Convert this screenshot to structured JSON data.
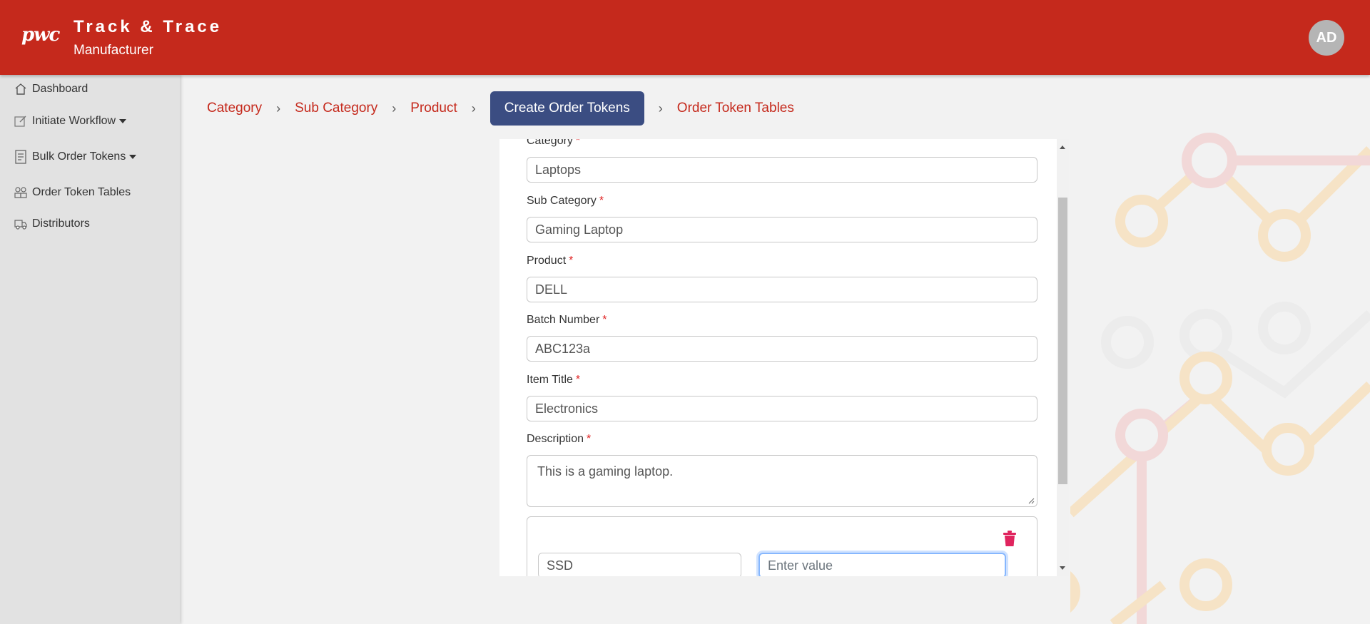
{
  "header": {
    "logo": "pwc",
    "title": "Track & Trace",
    "subtitle": "Manufacturer",
    "avatar_initials": "AD",
    "brand_color": "#c5291c"
  },
  "sidebar": {
    "items": [
      {
        "label": "Dashboard",
        "icon": "home-icon"
      },
      {
        "label": "Initiate Workflow",
        "icon": "edit-icon",
        "dropdown": true
      },
      {
        "label": "Bulk Order Tokens",
        "icon": "document-icon",
        "dropdown": true
      },
      {
        "label": "Order Token Tables",
        "icon": "users-icon"
      },
      {
        "label": "Distributors",
        "icon": "truck-icon"
      }
    ]
  },
  "breadcrumb": {
    "items": [
      "Category",
      "Sub Category",
      "Product",
      "Create Order Tokens",
      "Order Token Tables"
    ],
    "active": "Create Order Tokens",
    "active_color": "#3b4d82"
  },
  "form": {
    "fields": [
      {
        "label": "Category",
        "value": "Laptops"
      },
      {
        "label": "Sub Category",
        "value": "Gaming Laptop"
      },
      {
        "label": "Product",
        "value": "DELL"
      },
      {
        "label": "Batch Number",
        "value": "ABC123a"
      },
      {
        "label": "Item Title",
        "value": "Electronics"
      }
    ],
    "description": {
      "label": "Description",
      "value": "This is a gaming laptop."
    },
    "required_marker": "*",
    "attribute": {
      "key": "SSD",
      "value_placeholder": "Enter value"
    }
  }
}
